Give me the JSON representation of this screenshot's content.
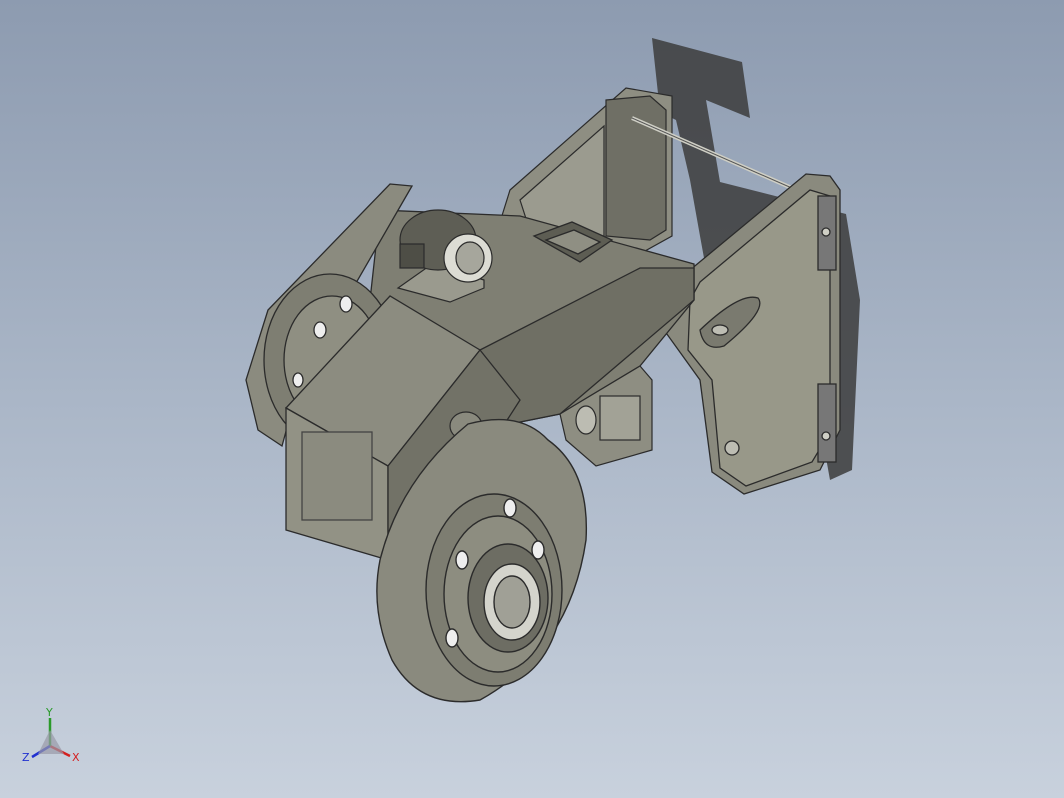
{
  "viewport": {
    "background_top": "#8d9bb0",
    "background_bottom": "#c8d1dd",
    "model_color": "#86867a",
    "model_shadow_color": "#3a3a3a"
  },
  "triad": {
    "x_label": "X",
    "y_label": "Y",
    "z_label": "Z",
    "x_color": "#d42020",
    "y_color": "#2a9a2a",
    "z_color": "#2030d0"
  }
}
